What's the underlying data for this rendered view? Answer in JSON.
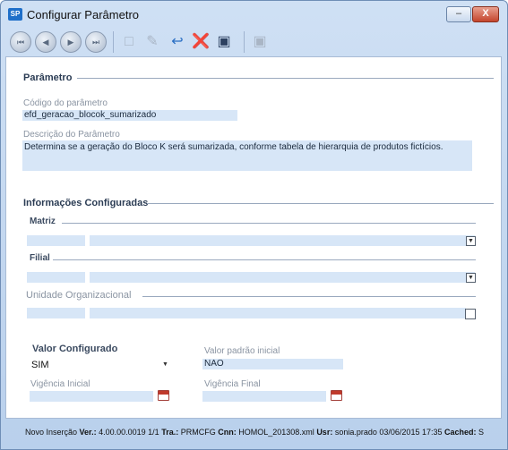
{
  "window": {
    "title": "Configurar Parâmetro",
    "app_icon": "SP",
    "minimize_label": "–",
    "close_label": "X"
  },
  "toolbar": {
    "icons": [
      "first-record-icon",
      "previous-record-icon",
      "next-record-icon",
      "last-record-icon",
      "new-document-icon",
      "edit-icon",
      "undo-icon",
      "delete-icon",
      "save-icon",
      "lock-icon"
    ]
  },
  "parametro": {
    "section_title": "Parâmetro",
    "codigo_label": "Código do parâmetro",
    "codigo_value": "efd_geracao_blocok_sumarizado",
    "descricao_label": "Descrição do Parâmetro",
    "descricao_value": "Determina se a geração do Bloco K será sumarizada, conforme tabela de hierarquia de produtos fictícios."
  },
  "informacoes": {
    "section_title": "Informações Configuradas",
    "matriz_label": "Matriz",
    "filial_label": "Filial",
    "unidade_label": "Unidade Organizacional"
  },
  "valor": {
    "configurado_label": "Valor Configurado",
    "configurado_value": "SIM",
    "padrao_label": "Valor padrão inicial",
    "padrao_value": "NAO",
    "vigencia_inicial_label": "Vigência Inicial",
    "vigencia_final_label": "Vigência Final"
  },
  "status": {
    "mode": "Novo Inserção",
    "ver_label": "Ver.:",
    "ver_value": "4.00.00.0019",
    "page": "1/1",
    "tra_label": "Tra.:",
    "tra_value": "PRMCFG",
    "cnn_label": "Cnn:",
    "cnn_value": "HOMOL_201308.xml",
    "usr_label": "Usr:",
    "usr_value": "sonia.prado",
    "datetime": "03/06/2015 17:35",
    "cached_label": "Cached:",
    "cached_value": "S"
  }
}
